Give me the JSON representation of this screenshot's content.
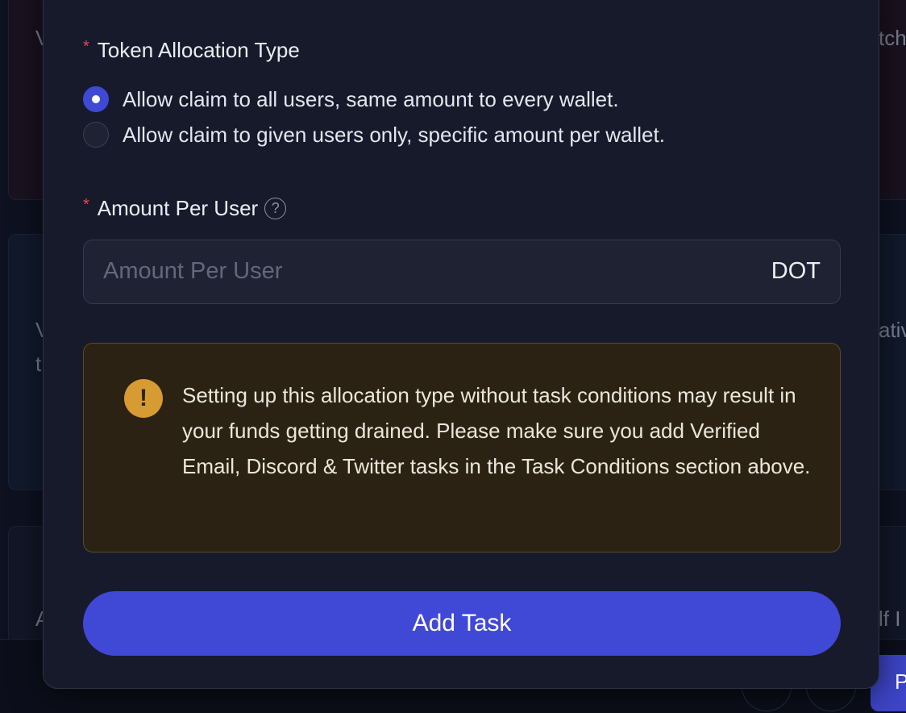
{
  "background": {
    "fragments": [
      "V",
      "tch",
      "V",
      "t",
      "ativ",
      "A",
      "lf I",
      "P"
    ]
  },
  "form": {
    "allocation_label": "Token Allocation Type",
    "allocation_options": [
      {
        "label": "Allow claim to all users, same amount to every wallet.",
        "selected": true
      },
      {
        "label": "Allow claim to given users only, specific amount per wallet.",
        "selected": false
      }
    ],
    "amount_label": "Amount Per User",
    "amount_placeholder": "Amount Per User",
    "amount_value": "",
    "amount_unit": "DOT",
    "help_glyph": "?",
    "required_marker": "*"
  },
  "warning": {
    "icon_glyph": "!",
    "text": "Setting up this allocation type without task conditions may result in your funds getting drained. Please make sure you add Verified Email, Discord & Twitter tasks in the Task Conditions section above."
  },
  "actions": {
    "add_task_label": "Add Task"
  },
  "colors": {
    "accent": "#4048d6",
    "required": "#e5484d",
    "warning_icon": "#d69b33",
    "warning_bg": "#2c2214",
    "modal_bg": "#161a2b"
  }
}
